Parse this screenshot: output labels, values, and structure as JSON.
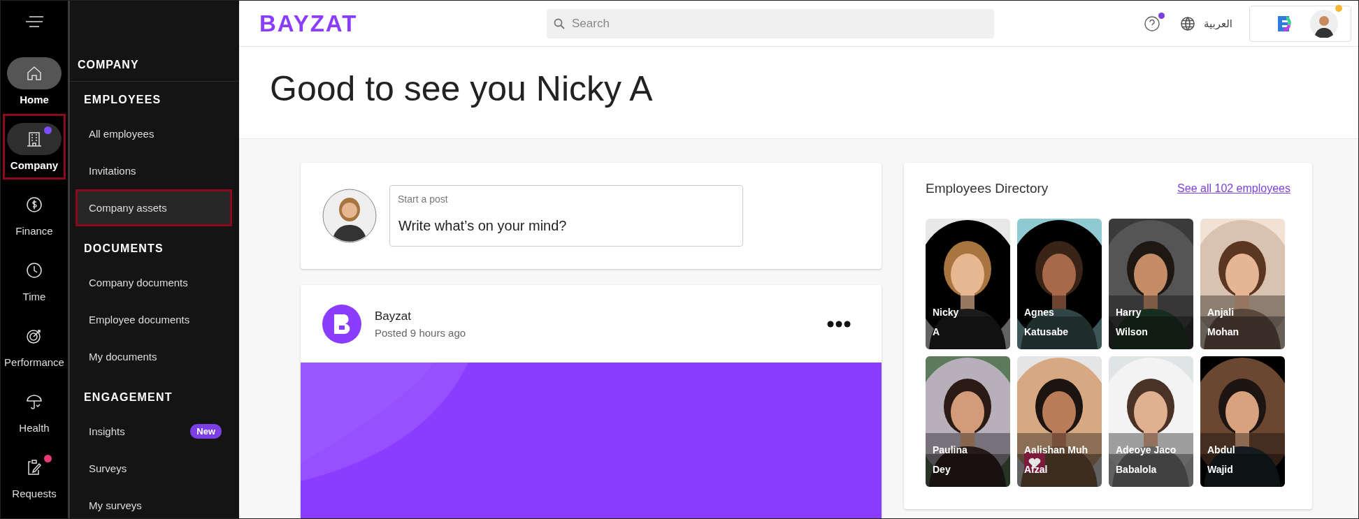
{
  "sidebar_rail": {
    "items": [
      {
        "label": "Home",
        "selected": true,
        "open": false,
        "highlighted": false
      },
      {
        "label": "Company",
        "selected": false,
        "open": true,
        "highlighted": true,
        "color": "#7c4dff"
      },
      {
        "label": "Finance",
        "selected": false,
        "open": false,
        "highlighted": false
      },
      {
        "label": "Time",
        "selected": false,
        "open": false,
        "highlighted": false
      },
      {
        "label": "Performance",
        "selected": false,
        "open": false,
        "highlighted": false
      },
      {
        "label": "Health",
        "selected": false,
        "open": false,
        "highlighted": false
      },
      {
        "label": "Requests",
        "selected": false,
        "open": false,
        "highlighted": false,
        "color": "#e6397a"
      }
    ]
  },
  "menu": {
    "title": "COMPANY",
    "sections": [
      {
        "heading": "EMPLOYEES",
        "items": [
          {
            "label": "All employees",
            "selected": false,
            "highlighted": false
          },
          {
            "label": "Invitations",
            "selected": false,
            "highlighted": false
          },
          {
            "label": "Company assets",
            "selected": true,
            "highlighted": true
          }
        ]
      },
      {
        "heading": "DOCUMENTS",
        "items": [
          {
            "label": "Company documents",
            "selected": false,
            "highlighted": false
          },
          {
            "label": "Employee documents",
            "selected": false,
            "highlighted": false
          },
          {
            "label": "My documents",
            "selected": false,
            "highlighted": false
          }
        ]
      },
      {
        "heading": "ENGAGEMENT",
        "items": [
          {
            "label": "Insights",
            "selected": false,
            "highlighted": false,
            "badge": "New"
          },
          {
            "label": "Surveys",
            "selected": false,
            "highlighted": false
          },
          {
            "label": "My surveys",
            "selected": false,
            "highlighted": false
          }
        ]
      }
    ]
  },
  "header": {
    "logo": "BAYZAT",
    "search": {
      "placeholder": "Search"
    },
    "help_notification": true,
    "language": "العربية",
    "profile_notification": true
  },
  "greeting": "Good to see you Nicky A",
  "composer": {
    "label": "Start a post",
    "placeholder": "Write what’s on your mind?"
  },
  "post": {
    "author": "Bayzat",
    "meta": "Posted 9 hours ago"
  },
  "directory": {
    "title": "Employees Directory",
    "link": "See all 102 employees",
    "employees": [
      {
        "first": "Nicky",
        "last": "A",
        "favorite": false
      },
      {
        "first": "Agnes",
        "last": "Katusabe",
        "favorite": false
      },
      {
        "first": "Harry",
        "last": "Wilson",
        "favorite": false
      },
      {
        "first": "Anjali",
        "last": "Mohan",
        "favorite": false
      },
      {
        "first": "Paulina",
        "last": "Dey",
        "favorite": false
      },
      {
        "first": "Aalishan Muh",
        "last": "Afzal",
        "favorite": true
      },
      {
        "first": "Adeoye Jaco",
        "last": "Babalola",
        "favorite": false
      },
      {
        "first": "Abdul",
        "last": "Wajid",
        "favorite": false
      }
    ]
  }
}
